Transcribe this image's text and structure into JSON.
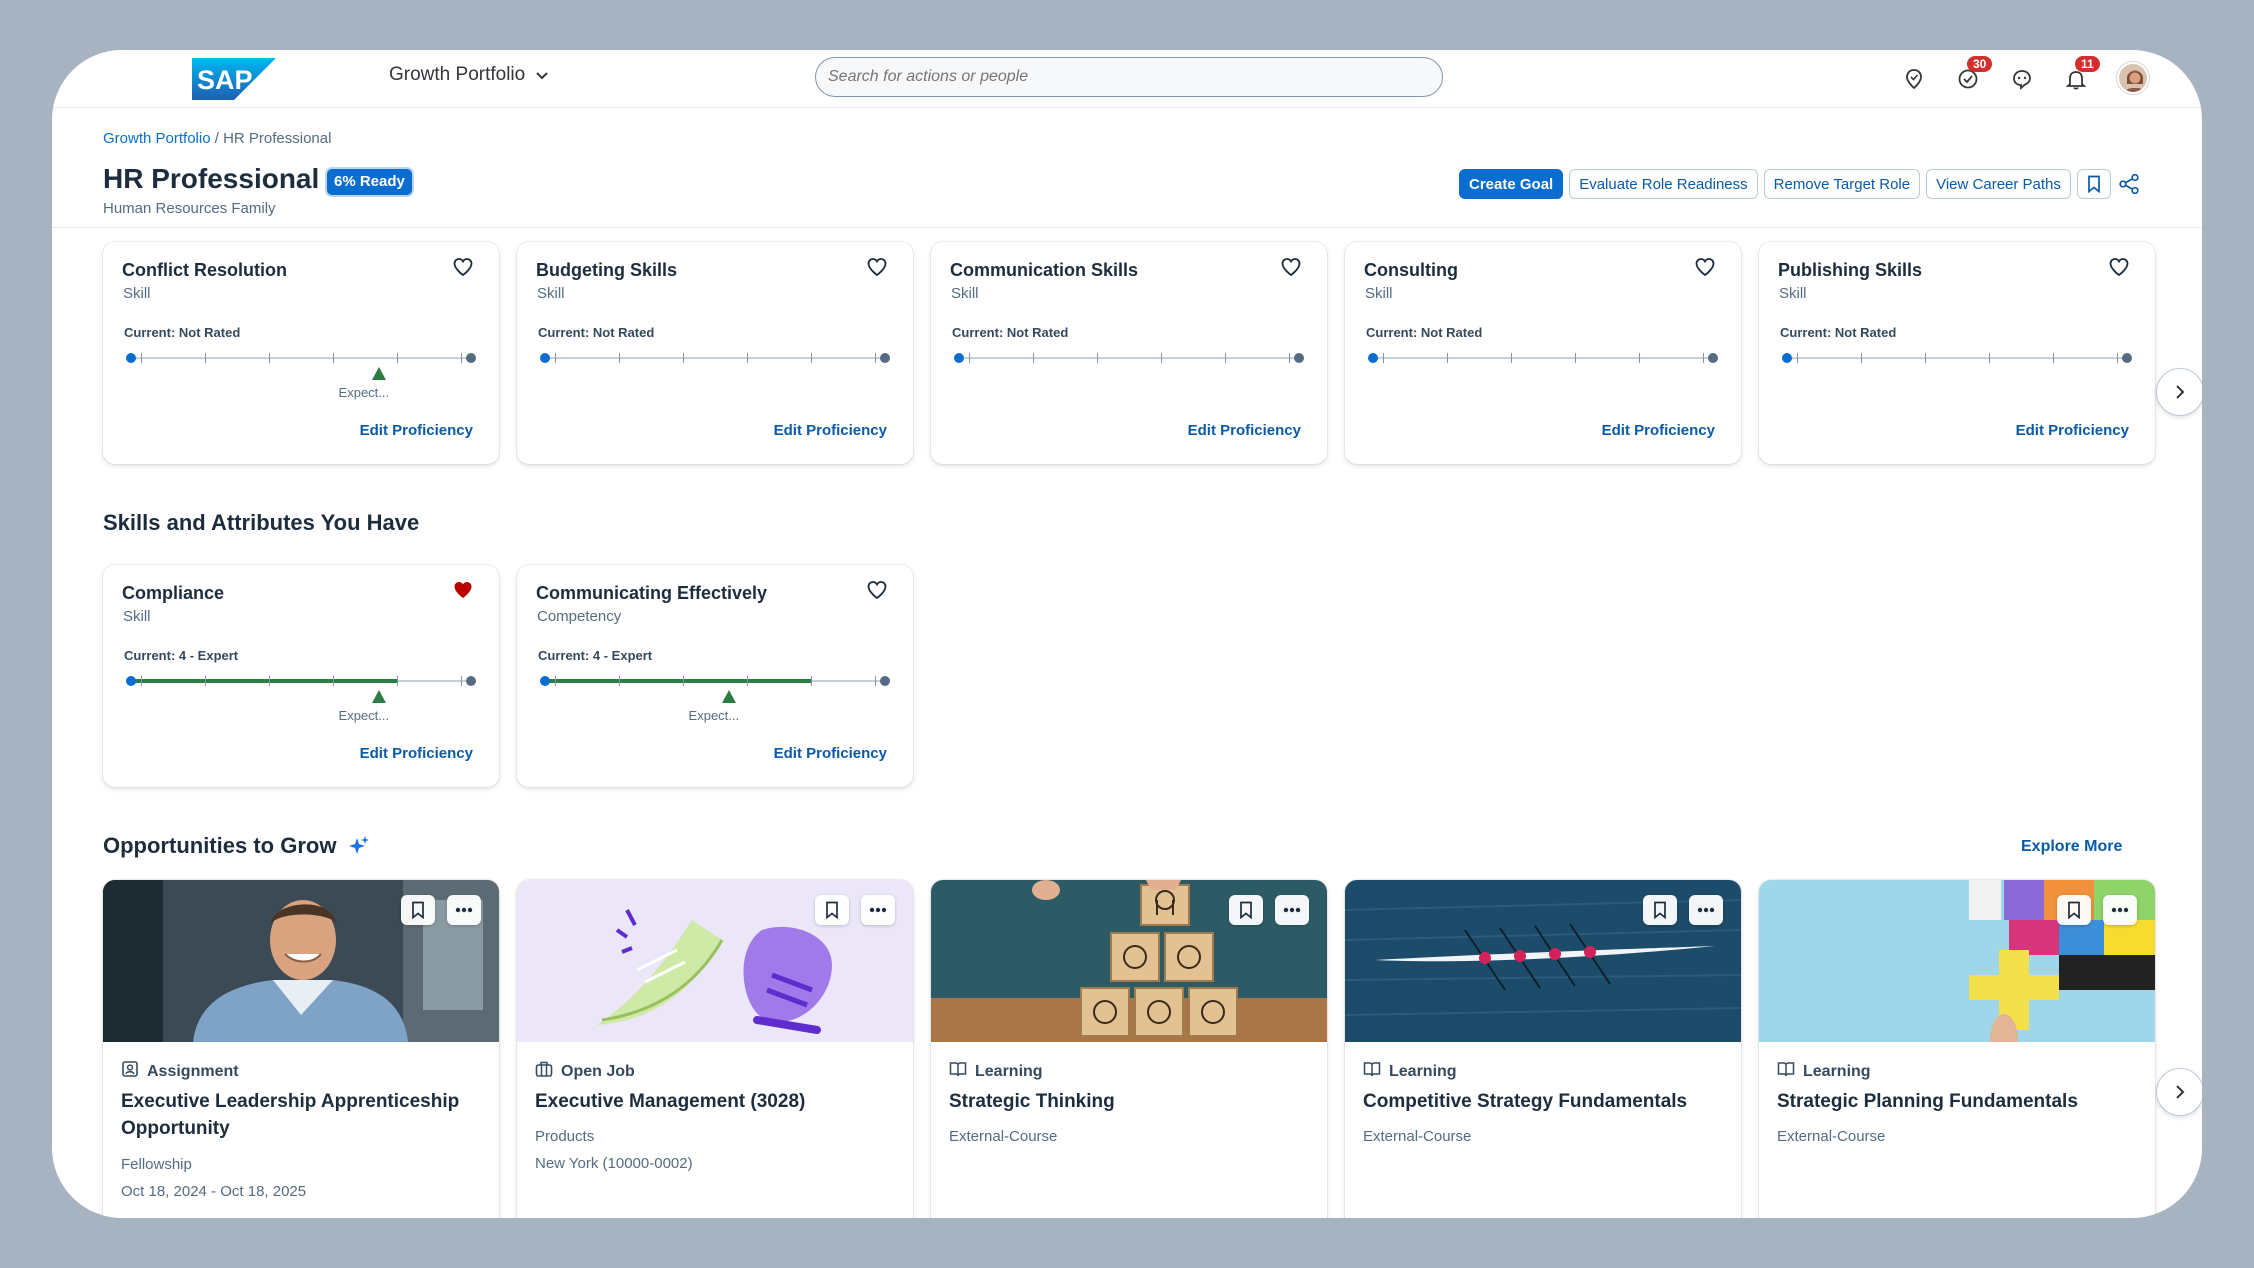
{
  "shell": {
    "logo_text": "SAP",
    "product_name": "Growth Portfolio",
    "search_placeholder": "Search for actions or people",
    "tasks_badge": "30",
    "notifications_badge": "11"
  },
  "header": {
    "breadcrumb_root": "Growth Portfolio",
    "breadcrumb_sep": " / ",
    "breadcrumb_current": "HR Professional",
    "title": "HR Professional",
    "readiness": "6% Ready",
    "subtitle": "Human Resources Family",
    "actions": {
      "create_goal": "Create Goal",
      "evaluate": "Evaluate Role Readiness",
      "remove_target": "Remove Target Role",
      "career_paths": "View Career Paths"
    }
  },
  "skills_to_develop": [
    {
      "name": "Conflict Resolution",
      "type": "Skill",
      "current": "Current: Not Rated",
      "current_level": 0,
      "expected_level": 4,
      "expected_label": "Expect...",
      "edit": "Edit Proficiency",
      "favorite": false
    },
    {
      "name": "Budgeting Skills",
      "type": "Skill",
      "current": "Current: Not Rated",
      "current_level": 0,
      "edit": "Edit Proficiency",
      "favorite": false
    },
    {
      "name": "Communication Skills",
      "type": "Skill",
      "current": "Current: Not Rated",
      "current_level": 0,
      "edit": "Edit Proficiency",
      "favorite": false
    },
    {
      "name": "Consulting",
      "type": "Skill",
      "current": "Current: Not Rated",
      "current_level": 0,
      "edit": "Edit Proficiency",
      "favorite": false
    },
    {
      "name": "Publishing Skills",
      "type": "Skill",
      "current": "Current: Not Rated",
      "current_level": 0,
      "edit": "Edit Proficiency",
      "favorite": false
    }
  ],
  "have_section_title": "Skills and Attributes You Have",
  "skills_have": [
    {
      "name": "Compliance",
      "type": "Skill",
      "current": "Current: 4 - Expert",
      "current_level": 4,
      "expected_level": 4,
      "expected_label": "Expect...",
      "edit": "Edit Proficiency",
      "favorite": true
    },
    {
      "name": "Communicating Effectively",
      "type": "Competency",
      "current": "Current: 4 - Expert",
      "current_level": 4,
      "expected_level": 3,
      "expected_label": "Expect...",
      "edit": "Edit Proficiency",
      "favorite": false
    }
  ],
  "opportunities_title": "Opportunities to Grow",
  "explore_more": "Explore More",
  "opportunities": [
    {
      "kind": "Assignment",
      "icon": "assignment-icon",
      "title": "Executive Leadership Apprenticeship Opportunity",
      "meta1": "Fellowship",
      "meta2": "Oct 18, 2024 - Oct 18, 2025"
    },
    {
      "kind": "Open Job",
      "icon": "briefcase-icon",
      "title": "Executive Management (3028)",
      "meta1": "Products",
      "meta2": "New York (10000-0002)"
    },
    {
      "kind": "Learning",
      "icon": "book-icon",
      "title": "Strategic Thinking",
      "meta1": "External-Course"
    },
    {
      "kind": "Learning",
      "icon": "book-icon",
      "title": "Competitive Strategy Fundamentals",
      "meta1": "External-Course"
    },
    {
      "kind": "Learning",
      "icon": "book-icon",
      "title": "Strategic Planning Fundamentals",
      "meta1": "External-Course"
    }
  ],
  "colors": {
    "brand": "#0a6ed1",
    "progress": "#2b7d44",
    "favorite_active": "#bb0000"
  }
}
